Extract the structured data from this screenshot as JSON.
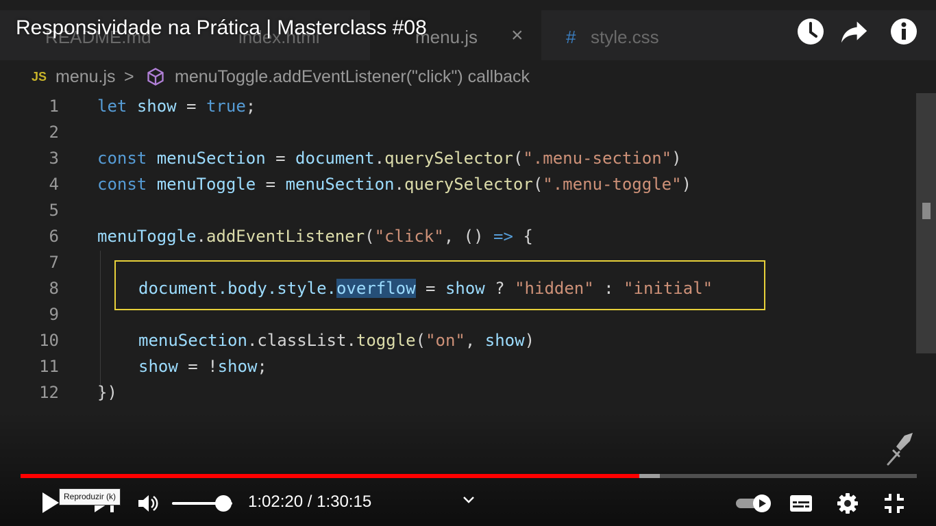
{
  "video_title": "Responsividade na Prática | Masterclass #08",
  "editor": {
    "tabs": [
      {
        "label": "README.md"
      },
      {
        "label": "index.html"
      },
      {
        "label": "menu.js"
      },
      {
        "label": "style.css"
      }
    ],
    "tab_close_glyph": "×",
    "hash_glyph": "#",
    "breadcrumb": {
      "file_icon_text": "JS",
      "file": "menu.js",
      "separator": ">",
      "symbol": "menuToggle.addEventListener(\"click\") callback"
    },
    "lines": [
      {
        "num": "1"
      },
      {
        "num": "2"
      },
      {
        "num": "3"
      },
      {
        "num": "4"
      },
      {
        "num": "5"
      },
      {
        "num": "6"
      },
      {
        "num": "7"
      },
      {
        "num": "8"
      },
      {
        "num": "9"
      },
      {
        "num": "10"
      },
      {
        "num": "11"
      },
      {
        "num": "12"
      }
    ],
    "code": {
      "l1_let": "let",
      "l1_show": "show",
      "l1_eq": " = ",
      "l1_true": "true",
      "l1_semi": ";",
      "l3_const": "const",
      "l3_name": "menuSection",
      "l3_eq": " = ",
      "l3_doc": "document",
      "l3_dot": ".",
      "l3_fn": "querySelector",
      "l3_open": "(",
      "l3_str": "\".menu-section\"",
      "l3_close": ")",
      "l4_const": "const",
      "l4_name": "menuToggle",
      "l4_eq": " = ",
      "l4_obj": "menuSection",
      "l4_dot": ".",
      "l4_fn": "querySelector",
      "l4_open": "(",
      "l4_str": "\".menu-toggle\"",
      "l4_close": ")",
      "l6_obj": "menuToggle",
      "l6_dot": ".",
      "l6_fn": "addEventListener",
      "l6_open": "(",
      "l6_str": "\"click\"",
      "l6_mid": ", () ",
      "l6_arrow": "=>",
      "l6_brace": " {",
      "l8_path": "document.body.style.",
      "l8_sel": "overflow",
      "l8_eq": " = ",
      "l8_show": "show",
      "l8_q": " ? ",
      "l8_s1": "\"hidden\"",
      "l8_c": " : ",
      "l8_s2": "\"initial\"",
      "l10_obj": "menuSection",
      "l10_rest": ".classList.",
      "l10_fn": "toggle",
      "l10_open": "(",
      "l10_str": "\"on\"",
      "l10_comma": ", ",
      "l10_show": "show",
      "l10_close": ")",
      "l11_show": "show",
      "l11_eq": " = !",
      "l11_show2": "show",
      "l11_semi": ";",
      "l12": "})"
    }
  },
  "player": {
    "progress_played_fraction": 0.6905,
    "progress_buffered_fraction": 0.7135,
    "volume_fraction": 0.85,
    "current_time": "1:02:20",
    "time_separator": " / ",
    "duration": "1:30:15",
    "tooltip": "Reproduzir (k)",
    "icons": {
      "watch_later": "clock-icon",
      "share": "share-icon",
      "info": "info-icon",
      "play": "play-icon",
      "next": "next-icon",
      "volume": "volume-icon",
      "chapters": "chevron-down-icon",
      "autoplay": "autoplay-toggle-icon",
      "subtitles": "subtitles-icon",
      "settings": "gear-icon",
      "exit_fullscreen": "exit-fullscreen-icon",
      "channel_watermark": "channel-watermark-icon"
    },
    "accent_color": "#ff0000"
  }
}
